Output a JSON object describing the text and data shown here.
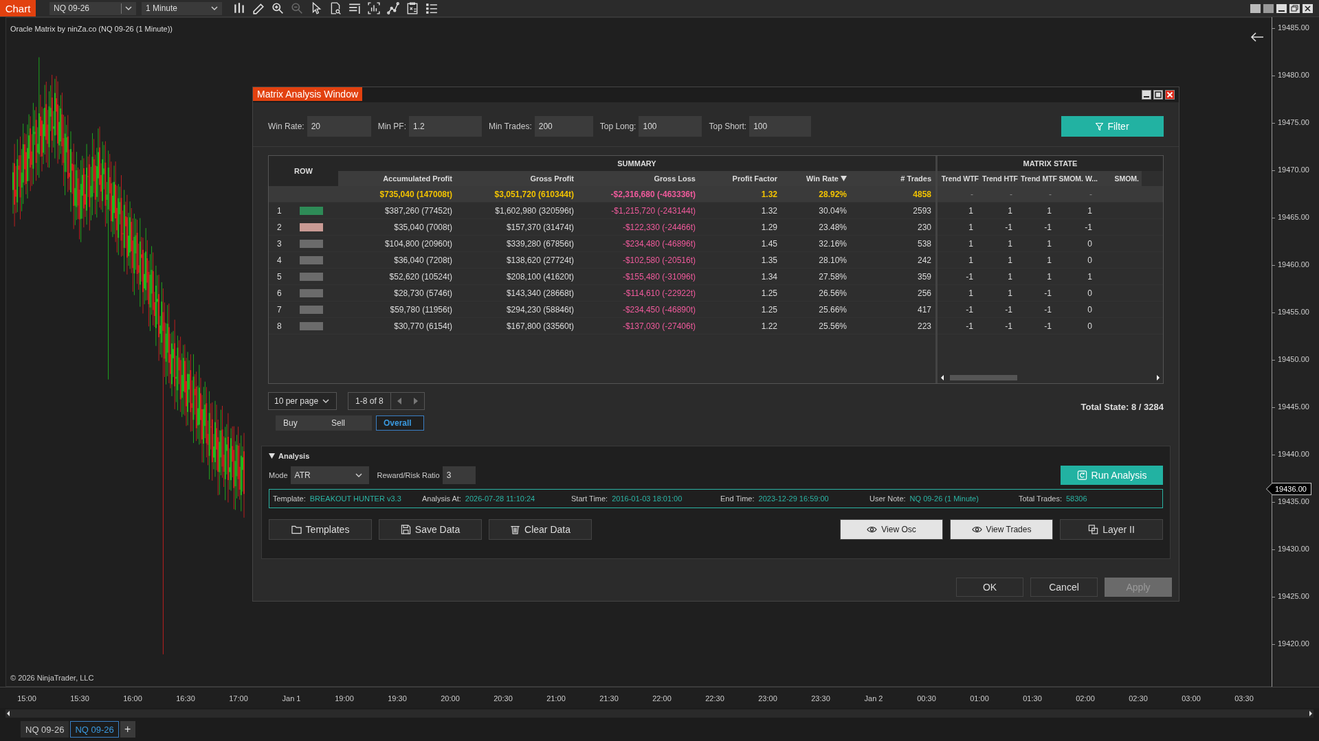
{
  "toolbar": {
    "app_button": "Chart",
    "instrument": "NQ 09-26",
    "interval": "1 Minute",
    "tools": [
      {
        "kind": "bars",
        "disabled": false
      },
      {
        "kind": "pencil",
        "disabled": false
      },
      {
        "kind": "zoom-in",
        "disabled": false
      },
      {
        "kind": "zoom-out",
        "disabled": true
      },
      {
        "kind": "cursor",
        "disabled": false
      },
      {
        "kind": "doc-search",
        "disabled": false
      },
      {
        "kind": "rows",
        "disabled": false
      },
      {
        "kind": "frame-bars",
        "disabled": false
      },
      {
        "kind": "line-points",
        "disabled": false
      },
      {
        "kind": "calc-doc",
        "disabled": false
      },
      {
        "kind": "list",
        "disabled": false
      }
    ]
  },
  "chart": {
    "title": "Oracle Matrix by ninZa.co (NQ 09-26 (1 Minute))",
    "copyright": "© 2026 NinjaTrader, LLC",
    "price_labels": [
      "19485.00",
      "19480.00",
      "19475.00",
      "19470.00",
      "19465.00",
      "19460.00",
      "19455.00",
      "19450.00",
      "19445.00",
      "19440.00",
      "19435.00",
      "19430.00",
      "19425.00",
      "19420.00"
    ],
    "current_price": "19436.00",
    "time_labels": [
      "15:00",
      "15:30",
      "16:00",
      "16:30",
      "17:00",
      "Jan 1",
      "19:00",
      "19:30",
      "20:00",
      "20:30",
      "21:00",
      "21:30",
      "22:00",
      "22:30",
      "23:00",
      "23:30",
      "Jan 2",
      "00:30",
      "01:00",
      "01:30",
      "02:00",
      "02:30",
      "03:00",
      "03:30"
    ]
  },
  "tabs": [
    {
      "label": "NQ 09-26",
      "selected": false
    },
    {
      "label": "NQ 09-26",
      "selected": true
    }
  ],
  "add_tab": "+",
  "dialog": {
    "title": "Matrix Analysis Window",
    "filters": [
      {
        "label": "Win Rate:",
        "value": "20"
      },
      {
        "label": "Min PF:",
        "value": "1.2"
      },
      {
        "label": "Min Trades:",
        "value": "200"
      },
      {
        "label": "Top Long:",
        "value": "100"
      },
      {
        "label": "Top Short:",
        "value": "100"
      }
    ],
    "filter_button": "Filter",
    "table": {
      "row_header": "ROW",
      "summary_header": "SUMMARY",
      "matrix_header": "MATRIX STATE",
      "columns": [
        {
          "label": "Accumulated Profit",
          "sorted": false
        },
        {
          "label": "Gross Profit",
          "sorted": false
        },
        {
          "label": "Gross Loss",
          "sorted": false
        },
        {
          "label": "Profit Factor",
          "sorted": false
        },
        {
          "label": "Win Rate",
          "sorted": true
        },
        {
          "label": "# Trades",
          "sorted": false
        }
      ],
      "matrix_columns": [
        "Trend WTF",
        "Trend HTF",
        "Trend MTF",
        "SMOM. W...",
        "SMOM."
      ],
      "totals": {
        "cells": [
          "$735,040 (147008t)",
          "$3,051,720 (610344t)",
          "-$2,316,680 (-463336t)",
          "1.32",
          "28.92%",
          "4858"
        ],
        "matrix": [
          "-",
          "-",
          "-",
          "-"
        ]
      },
      "rows": [
        {
          "row": "1",
          "color": "#2e8b57",
          "cells": [
            "$387,260 (77452t)",
            "$1,602,980 (320596t)",
            "-$1,215,720 (-243144t)",
            "1.32",
            "30.04%",
            "2593"
          ],
          "matrix": [
            "1",
            "1",
            "1",
            "1"
          ]
        },
        {
          "row": "2",
          "color": "#c99a94",
          "cells": [
            "$35,040 (7008t)",
            "$157,370 (31474t)",
            "-$122,330 (-24466t)",
            "1.29",
            "23.48%",
            "230"
          ],
          "matrix": [
            "1",
            "-1",
            "-1",
            "-1"
          ]
        },
        {
          "row": "3",
          "color": "#6b6b6b",
          "cells": [
            "$104,800 (20960t)",
            "$339,280 (67856t)",
            "-$234,480 (-46896t)",
            "1.45",
            "32.16%",
            "538"
          ],
          "matrix": [
            "1",
            "1",
            "1",
            "0"
          ]
        },
        {
          "row": "4",
          "color": "#6b6b6b",
          "cells": [
            "$36,040 (7208t)",
            "$138,620 (27724t)",
            "-$102,580 (-20516t)",
            "1.35",
            "28.10%",
            "242"
          ],
          "matrix": [
            "1",
            "1",
            "1",
            "0"
          ]
        },
        {
          "row": "5",
          "color": "#6b6b6b",
          "cells": [
            "$52,620 (10524t)",
            "$208,100 (41620t)",
            "-$155,480 (-31096t)",
            "1.34",
            "27.58%",
            "359"
          ],
          "matrix": [
            "-1",
            "1",
            "1",
            "1"
          ]
        },
        {
          "row": "6",
          "color": "#6b6b6b",
          "cells": [
            "$28,730 (5746t)",
            "$143,340 (28668t)",
            "-$114,610 (-22922t)",
            "1.25",
            "26.56%",
            "256"
          ],
          "matrix": [
            "1",
            "1",
            "-1",
            "0"
          ]
        },
        {
          "row": "7",
          "color": "#6b6b6b",
          "cells": [
            "$59,780 (11956t)",
            "$294,230 (58846t)",
            "-$234,450 (-46890t)",
            "1.25",
            "25.66%",
            "417"
          ],
          "matrix": [
            "-1",
            "-1",
            "-1",
            "0"
          ]
        },
        {
          "row": "8",
          "color": "#6b6b6b",
          "cells": [
            "$30,770 (6154t)",
            "$167,800 (33560t)",
            "-$137,030 (-27406t)",
            "1.22",
            "25.56%",
            "223"
          ],
          "matrix": [
            "-1",
            "-1",
            "-1",
            "0"
          ]
        }
      ]
    },
    "page_size": "10 per page",
    "pager": "1-8 of 8",
    "total_state": "Total State: 8 / 3284",
    "side_tabs": [
      {
        "label": "Buy",
        "selected": false
      },
      {
        "label": "Sell",
        "selected": false
      },
      {
        "label": "Overall",
        "selected": true
      }
    ],
    "analysis": {
      "title": "Analysis",
      "expanded": true,
      "mode_label": "Mode",
      "mode": "ATR",
      "ratio_label": "Reward/Risk Ratio",
      "ratio": "3",
      "run_button": "Run Analysis",
      "info": [
        {
          "label": "Template:",
          "value": "BREAKOUT HUNTER v3.3"
        },
        {
          "label": "Analysis At:",
          "value": "2026-07-28 11:10:24"
        },
        {
          "label": "Start Time:",
          "value": "2016-01-03 18:01:00"
        },
        {
          "label": "End Time:",
          "value": "2023-12-29 16:59:00"
        },
        {
          "label": "User Note:",
          "value": "NQ 09-26 (1 Minute)"
        },
        {
          "label": "Total Trades:",
          "value": "58306"
        }
      ],
      "buttons": [
        {
          "label": "Templates",
          "kind": "folder",
          "pressed": false
        },
        {
          "label": "Save Data",
          "kind": "floppy",
          "pressed": false
        },
        {
          "label": "Clear Data",
          "kind": "trash",
          "pressed": false
        },
        {
          "label": "View Osc",
          "kind": "eye",
          "pressed": true
        },
        {
          "label": "View Trades",
          "kind": "eye",
          "pressed": true
        },
        {
          "label": "Layer II",
          "kind": "layers",
          "pressed": false
        }
      ]
    },
    "footer": [
      {
        "label": "OK",
        "disabled": false
      },
      {
        "label": "Cancel",
        "disabled": false
      },
      {
        "label": "Apply",
        "disabled": true
      }
    ]
  }
}
